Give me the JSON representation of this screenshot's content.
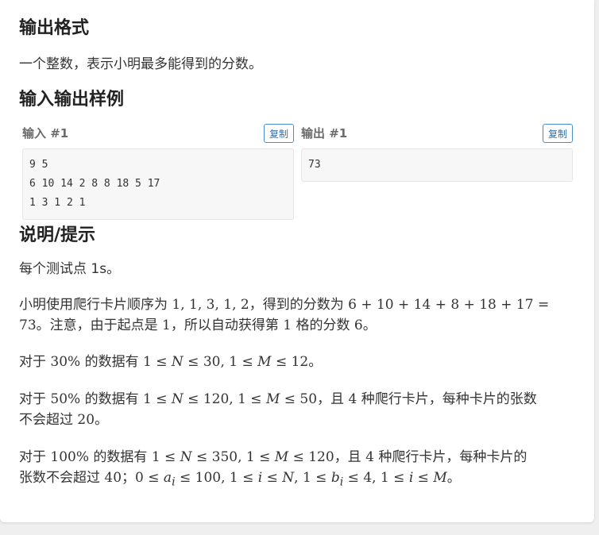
{
  "output_format": {
    "heading": "输出格式",
    "text": "一个整数，表示小明最多能得到的分数。"
  },
  "samples": {
    "heading": "输入输出样例",
    "input": {
      "title": "输入 #1",
      "copy_label": "复制",
      "lines": [
        "9 5",
        "6 10 14 2 8 8 18 5 17",
        "1 3 1 2 1"
      ]
    },
    "output": {
      "title": "输出 #1",
      "copy_label": "复制",
      "lines": [
        "73"
      ]
    }
  },
  "hint": {
    "heading": "说明/提示",
    "time_limit": "每个测试点 1s。",
    "example": {
      "t1": "小明使用爬行卡片顺序为 ",
      "m1": "1, 1, 3, 1, 2",
      "t2": "，得到的分数为 ",
      "m2": "6 + 10 + 14 + 8 + 18 + 17 =",
      "m3": "73",
      "t3": "。注意，由于起点是 ",
      "m4": "1",
      "t4": "，所以自动获得第 ",
      "m5": "1",
      "t5": " 格的分数 ",
      "m6": "6",
      "t6": "。"
    },
    "p30": {
      "t1": "对于 ",
      "m1": "30%",
      "t2": " 的数据有 ",
      "m2": "1 ≤ ",
      "v1": "N",
      "m3": " ≤ 30, 1 ≤ ",
      "v2": "M",
      "m4": " ≤ 12",
      "t3": "。"
    },
    "p50": {
      "t1": "对于 ",
      "m1": "50%",
      "t2": " 的数据有 ",
      "m2": "1 ≤ ",
      "v1": "N",
      "m3": " ≤ 120, 1 ≤ ",
      "v2": "M",
      "m4": " ≤ 50",
      "t3": "，且 ",
      "m5": "4",
      "t4": " 种爬行卡片，每种卡片的张数",
      "t5": "不会超过 ",
      "m6": "20",
      "t6": "。"
    },
    "p100": {
      "t1": "对于 ",
      "m1": "100%",
      "t2": " 的数据有 ",
      "m2": "1 ≤ ",
      "v1": "N",
      "m3": " ≤ 350, 1 ≤ ",
      "v2": "M",
      "m4": " ≤ 120",
      "t3": "，且 ",
      "m5": "4",
      "t4": " 种爬行卡片，每种卡片的",
      "t5": "张数不会超过 ",
      "m6": "40",
      "t6": "；",
      "m7": "0 ≤ ",
      "v3": "a",
      "s1": "i",
      "m8": " ≤ 100, 1 ≤ ",
      "v4": "i",
      "m9": " ≤ ",
      "v5": "N",
      "m10": ", 1 ≤ ",
      "v6": "b",
      "s2": "i",
      "m11": " ≤ 4, 1 ≤ ",
      "v7": "i",
      "m12": " ≤ ",
      "v8": "M",
      "t7": "。"
    }
  }
}
